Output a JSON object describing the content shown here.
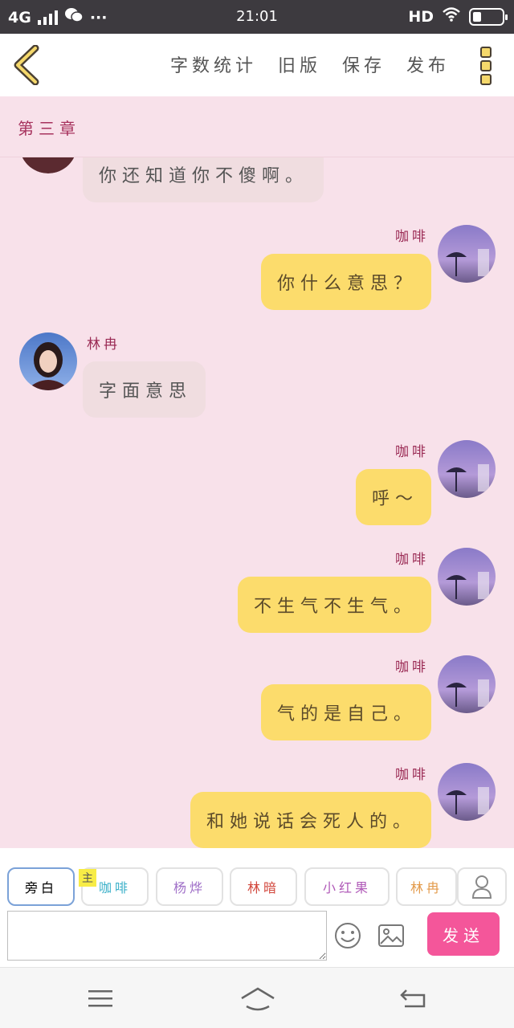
{
  "status": {
    "network": "4G",
    "time": "21:01",
    "hd": "HD"
  },
  "toolbar": {
    "items": [
      "字数统计",
      "旧版",
      "保存",
      "发布"
    ]
  },
  "chapter": {
    "title": "第三章"
  },
  "messages": [
    {
      "side": "in",
      "name": "",
      "text": "你还知道你不傻啊。"
    },
    {
      "side": "out",
      "name": "咖啡",
      "text": "你什么意思？"
    },
    {
      "side": "in",
      "name": "林冉",
      "text": "字面意思"
    },
    {
      "side": "out",
      "name": "咖啡",
      "text": "呼～"
    },
    {
      "side": "out",
      "name": "咖啡",
      "text": "不生气不生气。"
    },
    {
      "side": "out",
      "name": "咖啡",
      "text": "气的是自己。"
    },
    {
      "side": "out",
      "name": "咖啡",
      "text": "和她说话会死人的。"
    }
  ],
  "roles": {
    "main_tag": "主",
    "items": [
      {
        "label": "旁白",
        "color": "#555555"
      },
      {
        "label": "咖啡",
        "color": "#3bb0c9"
      },
      {
        "label": "杨烨",
        "color": "#a070c8"
      },
      {
        "label": "林暗",
        "color": "#d2473c"
      },
      {
        "label": "小红果",
        "color": "#b05ab8"
      },
      {
        "label": "林冉",
        "color": "#e39a4a"
      }
    ]
  },
  "input": {
    "value": "",
    "placeholder": "",
    "send_label": "发送"
  },
  "colors": {
    "incoming_bubble": "#f0dde0",
    "outgoing_bubble": "#fcdc6c",
    "send_button": "#f4569a",
    "background": "#f8e1ea"
  }
}
